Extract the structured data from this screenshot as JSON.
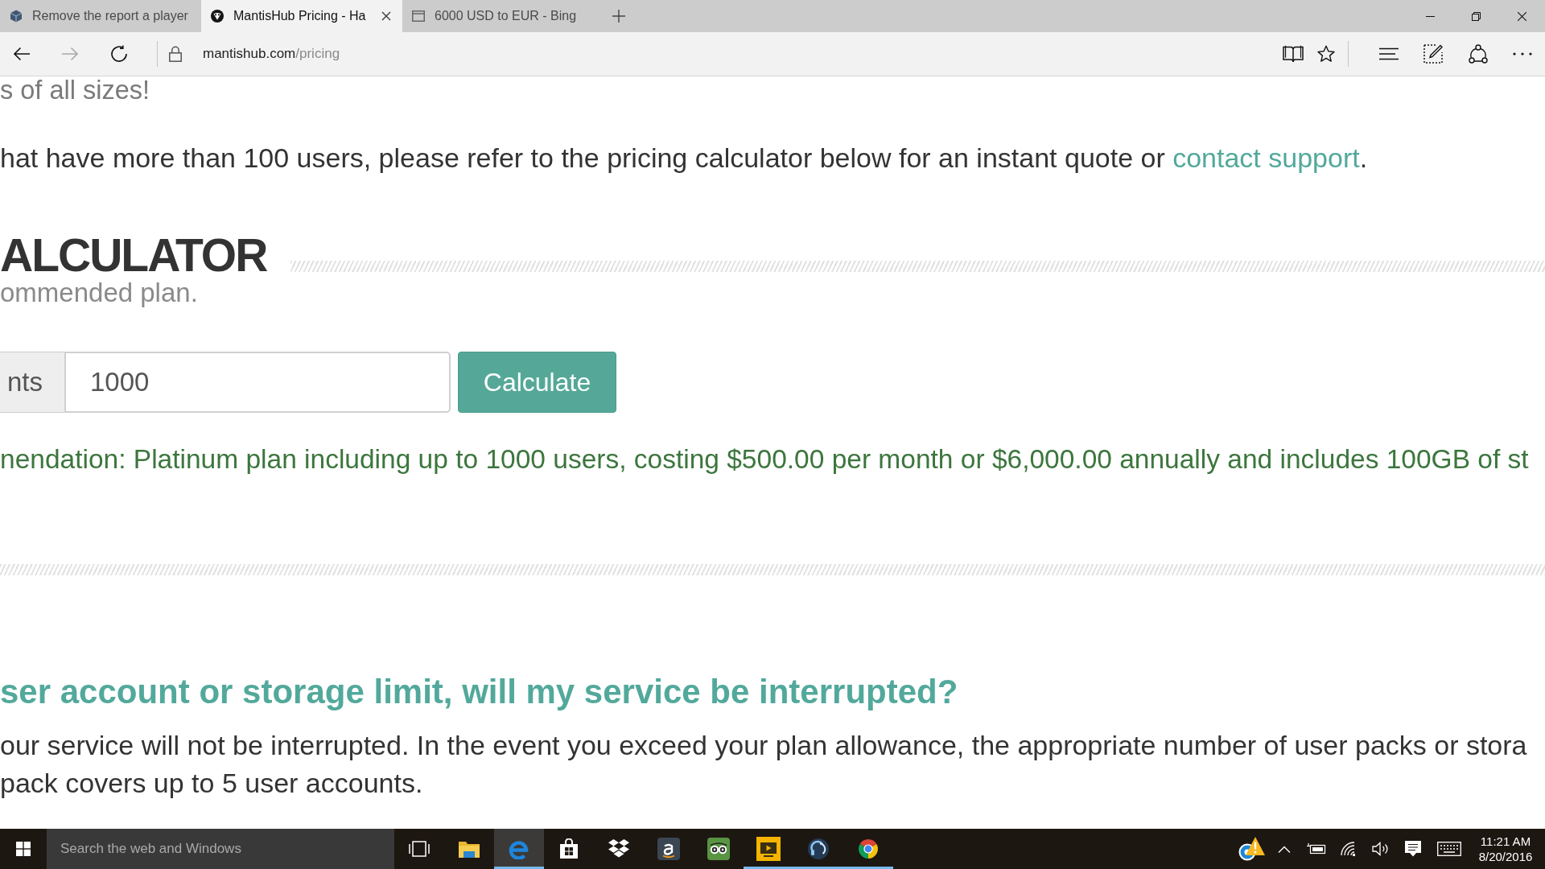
{
  "browser": {
    "tabs": [
      {
        "title": "Remove the report a player",
        "selected": false
      },
      {
        "title": "MantisHub Pricing - Ha",
        "selected": true
      },
      {
        "title": "6000 USD to EUR - Bing",
        "selected": false
      }
    ],
    "toolbar": {
      "back": {
        "disabled": false
      },
      "forward": {
        "disabled": true
      }
    },
    "address": {
      "domain": "mantishub.com",
      "path": "/pricing"
    }
  },
  "page": {
    "intro": "s of all sizes!",
    "note": {
      "before": "hat have more than 100 users, please refer to the pricing calculator below for an instant quote or ",
      "link": "contact support",
      "after": "."
    },
    "calculator": {
      "title": "ALCULATOR",
      "subtitle": "ommended plan.",
      "field_label": "nts",
      "value": "1000",
      "button": "Calculate",
      "result": "nendation: Platinum plan including up to 1000 users, costing $500.00 per month or $6,000.00 annually and includes 100GB of st"
    },
    "faq": {
      "question": "ser account or storage limit, will my service be interrupted?",
      "answer_lines": [
        "our service will not be interrupted. In the event you exceed your plan allowance, the appropriate number of user packs or stora",
        "pack covers up to 5 user accounts."
      ]
    }
  },
  "taskbar": {
    "search": {
      "placeholder": "Search the web and Windows"
    },
    "apps": [
      {
        "running": false,
        "selected": false
      },
      {
        "running": true,
        "selected": true
      },
      {
        "running": false,
        "selected": false
      },
      {
        "running": false,
        "selected": false
      },
      {
        "running": false,
        "selected": false
      },
      {
        "running": false,
        "selected": false
      },
      {
        "running": true,
        "selected": false
      },
      {
        "running": true,
        "selected": false
      },
      {
        "running": true,
        "selected": false
      }
    ],
    "clock": {
      "time": "11:21 AM",
      "date": "8/20/2016"
    }
  }
}
